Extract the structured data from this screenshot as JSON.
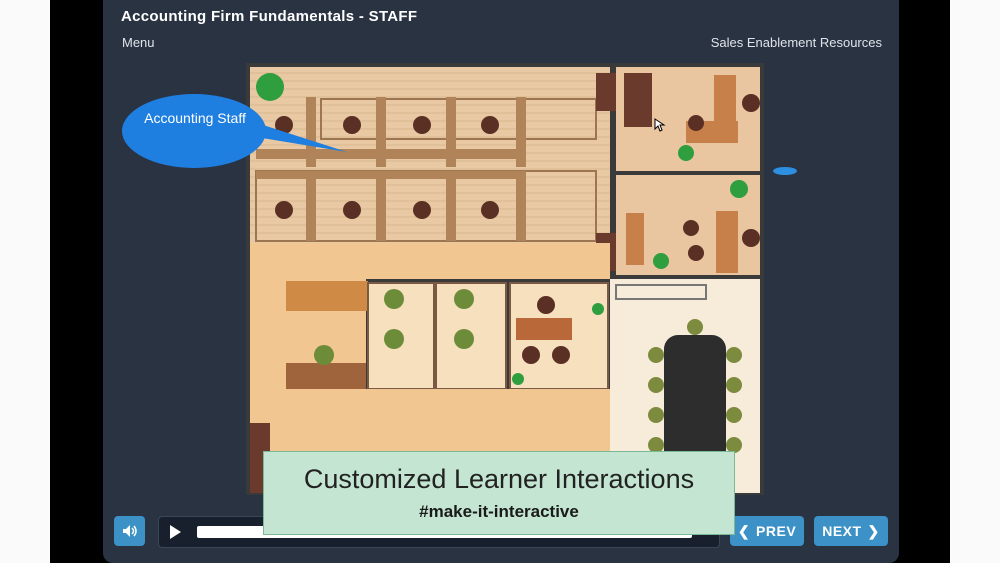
{
  "header": {
    "title": "Accounting Firm Fundamentals - STAFF",
    "menu_label": "Menu",
    "resources_label": "Sales Enablement Resources"
  },
  "stage": {
    "callout_text": "Accounting Staff"
  },
  "caption": {
    "line1": "Customized Learner Interactions",
    "line2": "#make-it-interactive"
  },
  "controls": {
    "volume_icon": "speaker-icon",
    "play_icon": "play-icon",
    "prev_label": "PREV",
    "next_label": "NEXT",
    "prev_icon": "chevron-left-icon",
    "next_icon": "chevron-right-icon"
  },
  "colors": {
    "player_bg": "#2a3342",
    "accent": "#3c91c7",
    "callout": "#1e7fe0",
    "caption_bg": "#c3e5d2"
  }
}
